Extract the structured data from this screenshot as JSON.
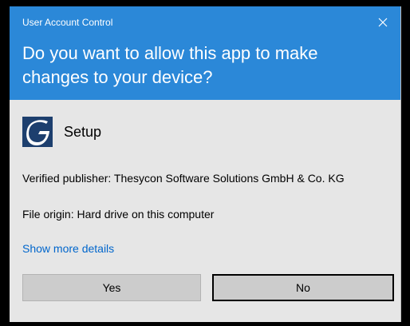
{
  "window": {
    "title": "User Account Control",
    "close_icon": "close-icon"
  },
  "prompt": {
    "question": "Do you want to allow this app to make changes to your device?"
  },
  "app": {
    "name": "Setup",
    "icon": "setup-app-icon"
  },
  "details": {
    "publisher": "Verified publisher: Thesycon Software Solutions GmbH & Co. KG",
    "origin": "File origin: Hard drive on this computer",
    "show_more": "Show more details"
  },
  "buttons": {
    "yes": "Yes",
    "no": "No"
  },
  "colors": {
    "header": "#2b88d8",
    "body": "#e6e6e6",
    "link": "#0066cc",
    "button": "#cccccc"
  }
}
